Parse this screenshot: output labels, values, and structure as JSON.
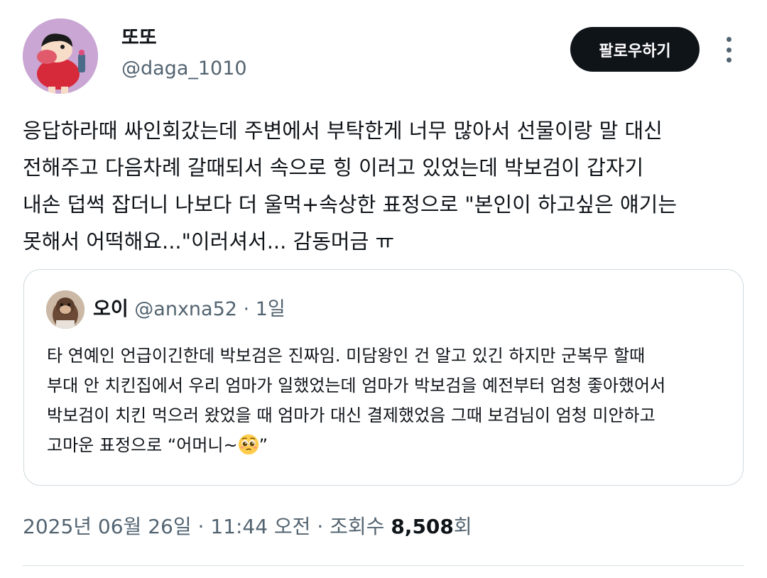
{
  "author": {
    "display_name": "또또",
    "handle": "@daga_1010"
  },
  "follow_button_label": "팔로우하기",
  "tweet": {
    "lines": [
      "응답하라때 싸인회갔는데 주변에서 부탁한게 너무 많아서 선물이랑 말 대신",
      "전해주고 다음차례 갈때되서 속으로 힝 이러고 있었는데 박보검이 갑자기",
      "내손 덥썩 잡더니 나보다 더 울먹+속상한 표정으로 \"본인이 하고싶은 얘기는",
      "못해서 어떡해요...\"이러셔서... 감동머금 ㅠ"
    ]
  },
  "quote": {
    "display_name": "오이",
    "handle": "@anxna52",
    "separator": " · ",
    "time": "1일",
    "lines": [
      "타 연예인 언급이긴한데 박보검은 진짜임. 미담왕인 건 알고 있긴 하지만 군복무 할때",
      "부대 안 치킨집에서 우리 엄마가 일했었는데 엄마가 박보검을 예전부터 엄청 좋아했어서",
      "박보검이 치킨 먹으러 왔었을 때 엄마가 대신 결제했었음 그때 보검님이 엄청 미안하고"
    ],
    "last_line_text": "고마운 표정으로 “어머니~",
    "last_line_end": "”",
    "emoji": "pleading-face-icon"
  },
  "meta": {
    "date": "2025년 06월 26일",
    "separator": " · ",
    "time": "11:44 오전",
    "views_label": "조회수 ",
    "views_count": "8,508",
    "views_suffix": "회"
  },
  "colors": {
    "text": "#0f1419",
    "secondary": "#536471",
    "border": "#cfd9de",
    "button_bg": "#0f1419",
    "button_text": "#ffffff"
  }
}
